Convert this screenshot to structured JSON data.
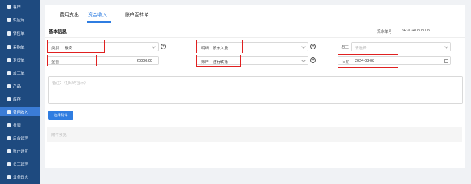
{
  "sidebar": {
    "items": [
      {
        "label": "客户"
      },
      {
        "label": "供应商"
      },
      {
        "label": "销售单"
      },
      {
        "label": "采购单"
      },
      {
        "label": "退货单"
      },
      {
        "label": "加工单"
      },
      {
        "label": "产品"
      },
      {
        "label": "库存"
      },
      {
        "label": "费用收入"
      },
      {
        "label": "报表"
      },
      {
        "label": "后台管理"
      },
      {
        "label": "账户设置"
      },
      {
        "label": "员工管理"
      },
      {
        "label": "业务日志"
      }
    ],
    "active_index": 8
  },
  "tabs": [
    {
      "label": "费用支出"
    },
    {
      "label": "资金收入"
    },
    {
      "label": "账户互转单"
    }
  ],
  "active_tab_index": 1,
  "form": {
    "section_title": "基本信息",
    "serial_label": "流水单号",
    "serial_value": "SR20240808005",
    "category_label": "类别",
    "category_value": "融资",
    "subject_label": "明细",
    "subject_value": "股东入股",
    "employee_label": "员工",
    "employee_placeholder": "请选择",
    "amount_label": "金额",
    "amount_value": "20000.00",
    "account_label": "账户",
    "account_value": "建行转账",
    "date_label": "日期",
    "date_value": "2024-08-08",
    "remark_placeholder": "备注：（打印时显示）",
    "upload_button": "选择附件",
    "attachment_placeholder": "附件预览"
  },
  "colors": {
    "sidebar_bg": "#1e4a7f",
    "sidebar_active": "#3b7cd6",
    "accent": "#2f7de1",
    "highlight": "#e02020"
  }
}
